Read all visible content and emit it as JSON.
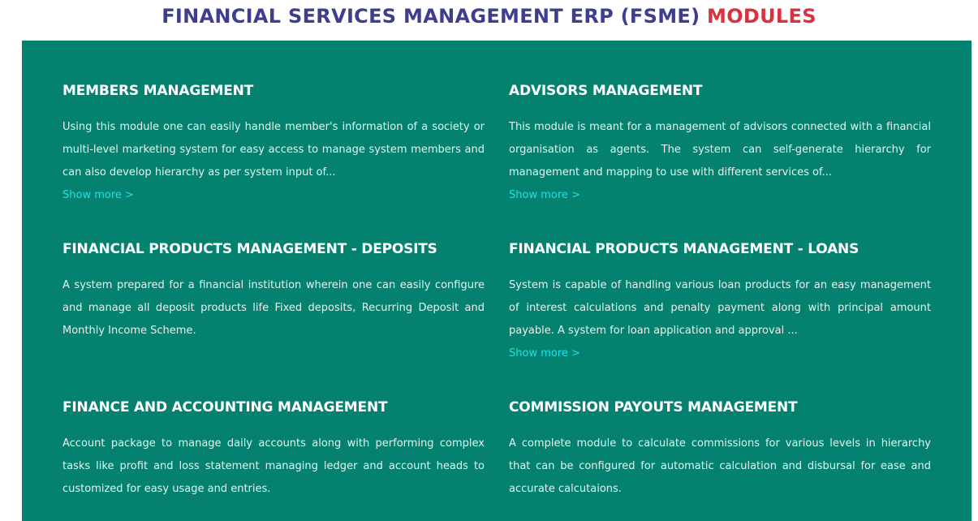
{
  "header": {
    "title_main": "FINANCIAL SERVICES MANAGEMENT ERP (FSME)",
    "title_accent": "MODULES"
  },
  "colors": {
    "title_main": "#3d3f8e",
    "title_accent": "#d7323f",
    "panel_background": "#05826f",
    "link": "#1fe0ea"
  },
  "modules": [
    {
      "title": "MEMBERS MANAGEMENT",
      "description": "Using this module one can easily handle member's information of a society or multi-level marketing system for easy access to manage system members and can also develop hierarchy as per system input of...",
      "link": "Show more >"
    },
    {
      "title": "ADVISORS MANAGEMENT",
      "description": "This module is meant for a management of advisors connected with a financial organisation as agents. The system can self-generate hierarchy for management and mapping to use with different services of...",
      "link": "Show more >"
    },
    {
      "title": "FINANCIAL PRODUCTS MANAGEMENT - DEPOSITS",
      "description": "A system prepared for a financial institution wherein one can easily configure and manage all deposit products life Fixed deposits, Recurring Deposit and Monthly Income Scheme."
    },
    {
      "title": "FINANCIAL PRODUCTS MANAGEMENT - LOANS",
      "description": "System is capable of handling various loan products for an easy management of interest calculations and penalty payment along with principal amount payable. A system for loan application and approval ...",
      "link": "Show more >"
    },
    {
      "title": "FINANCE AND ACCOUNTING MANAGEMENT",
      "description": "Account package to manage daily accounts along with performing complex tasks like profit and loss statement managing ledger and account heads to customized for easy usage and entries."
    },
    {
      "title": "COMMISSION PAYOUTS MANAGEMENT",
      "description": "A complete module to calculate commissions for various levels in hierarchy that can be configured for automatic calculation and disbursal for ease and accurate calcutaions."
    }
  ]
}
